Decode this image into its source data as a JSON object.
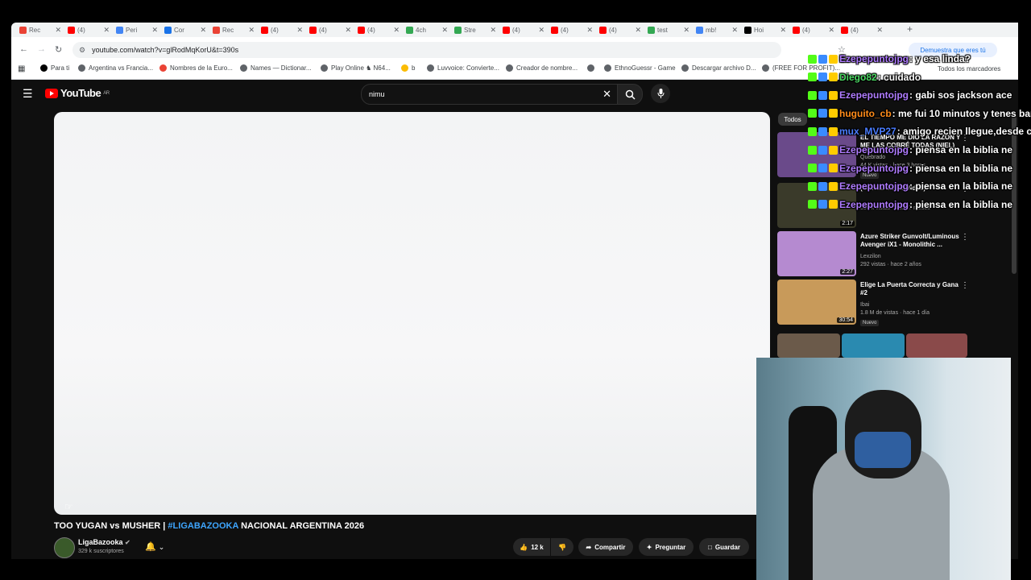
{
  "browser": {
    "url": "youtube.com/watch?v=glRodMqKorU&t=390s",
    "tabs": [
      {
        "label": "Rec",
        "color": "#ea4335"
      },
      {
        "label": "(4)",
        "color": "#ff0000"
      },
      {
        "label": "Peri",
        "color": "#4285f4"
      },
      {
        "label": "Cor",
        "color": "#1a73e8"
      },
      {
        "label": "Rec",
        "color": "#ea4335"
      },
      {
        "label": "(4)",
        "color": "#ff0000"
      },
      {
        "label": "(4)",
        "color": "#ff0000"
      },
      {
        "label": "(4)",
        "color": "#ff0000"
      },
      {
        "label": "4ch",
        "color": "#34a853"
      },
      {
        "label": "Stre",
        "color": "#34a853"
      },
      {
        "label": "(4)",
        "color": "#ff0000"
      },
      {
        "label": "(4)",
        "color": "#ff0000"
      },
      {
        "label": "(4)",
        "color": "#ff0000"
      },
      {
        "label": "test",
        "color": "#34a853"
      },
      {
        "label": "mb!",
        "color": "#4285f4"
      },
      {
        "label": "Hoi",
        "color": "#000000"
      },
      {
        "label": "(4)",
        "color": "#ff0000"
      },
      {
        "label": "(4)",
        "color": "#ff0000"
      }
    ],
    "bookmarks": [
      {
        "label": "Para ti",
        "color": "#000000"
      },
      {
        "label": "Argentina vs Francia...",
        "color": "#5f6368"
      },
      {
        "label": "Nombres de la Euro...",
        "color": "#ea4335"
      },
      {
        "label": "Names — Dictionar...",
        "color": "#5f6368"
      },
      {
        "label": "Play Online ♞ N64...",
        "color": "#5f6368"
      },
      {
        "label": "b",
        "color": "#fbbc04"
      },
      {
        "label": "Luvvoice: Convierte...",
        "color": "#5f6368"
      },
      {
        "label": "Creador de nombre...",
        "color": "#5f6368"
      },
      {
        "label": "",
        "color": "#5f6368"
      },
      {
        "label": "EthnoGuessr - Game",
        "color": "#5f6368"
      },
      {
        "label": "Descargar archivo D...",
        "color": "#5f6368"
      },
      {
        "label": "(FREE FOR PROFIT)...",
        "color": "#5f6368"
      }
    ],
    "all_bookmarks": "Todos los marcadores",
    "profile_hint": "Demuestra que eres tú"
  },
  "youtube": {
    "logo": "YouTube",
    "region": "AR",
    "search_value": "nimu",
    "video": {
      "title_pre": "TOO YUGAN vs MUSHER | ",
      "title_tag": "#LIGABAZOOKA",
      "title_post": " NACIONAL ARGENTINA 2026",
      "channel": "LigaBazooka",
      "subscribers": "329 k suscriptores",
      "likes": "12 k",
      "share": "Compartir",
      "ask": "Preguntar",
      "save": "Guardar"
    },
    "sidebar": {
      "chip_all": "Todos",
      "recommendations": [
        {
          "title": "EL TIEMPO ME DIO LA RAZÓN Y ME LAS COBRÉ TODAS (NIEL)",
          "channel": "Quebrado",
          "meta": "44 K vistas · hace 3 horas",
          "badge": "Nuevo",
          "duration": "",
          "color": "#6a4a8a"
        },
        {
          "title": "(Official Music Video)",
          "channel": "",
          "meta": "350 k vistas · hace 7 meses",
          "badge": "",
          "duration": "2:17",
          "color": "#3a3a2a"
        },
        {
          "title": "Azure Striker Gunvolt/Luminous Avenger iX1 - Monolithic ...",
          "channel": "Lexzilon",
          "meta": "292 vistas · hace 2 años",
          "badge": "",
          "duration": "2:27",
          "color": "#b58ad0"
        },
        {
          "title": "Elige La Puerta Correcta y Gana #2",
          "channel": "Ibai",
          "meta": "1.8 M de vistas · hace 1 día",
          "badge": "Nuevo",
          "duration": "30:54",
          "color": "#c89a5a"
        }
      ]
    }
  },
  "chat": [
    {
      "user": "Ezepepuntojpg",
      "user_color": "#b07cff",
      "msg": ": y esa linda?"
    },
    {
      "user": "Diego82",
      "user_color": "#4cd964",
      "msg": ": cuidado"
    },
    {
      "user": "Ezepepuntojpg",
      "user_color": "#b07cff",
      "msg": ": gabi sos jackson ace"
    },
    {
      "user": "huguito_cb",
      "user_color": "#ff8c1a",
      "msg": ": me fui 10 minutos y tenes bar"
    },
    {
      "user": "mux_MVP27",
      "user_color": "#4a7dff",
      "msg": ": amigo recien llegue,desde cua"
    },
    {
      "user": "Ezepepuntojpg",
      "user_color": "#b07cff",
      "msg": ": piensa en la biblia ne"
    },
    {
      "user": "Ezepepuntojpg",
      "user_color": "#b07cff",
      "msg": ": piensa en la biblia ne"
    },
    {
      "user": "Ezepepuntojpg",
      "user_color": "#b07cff",
      "msg": ": piensa en la biblia ne"
    },
    {
      "user": "Ezepepuntojpg",
      "user_color": "#b07cff",
      "msg": ": piensa en la biblia ne"
    }
  ]
}
